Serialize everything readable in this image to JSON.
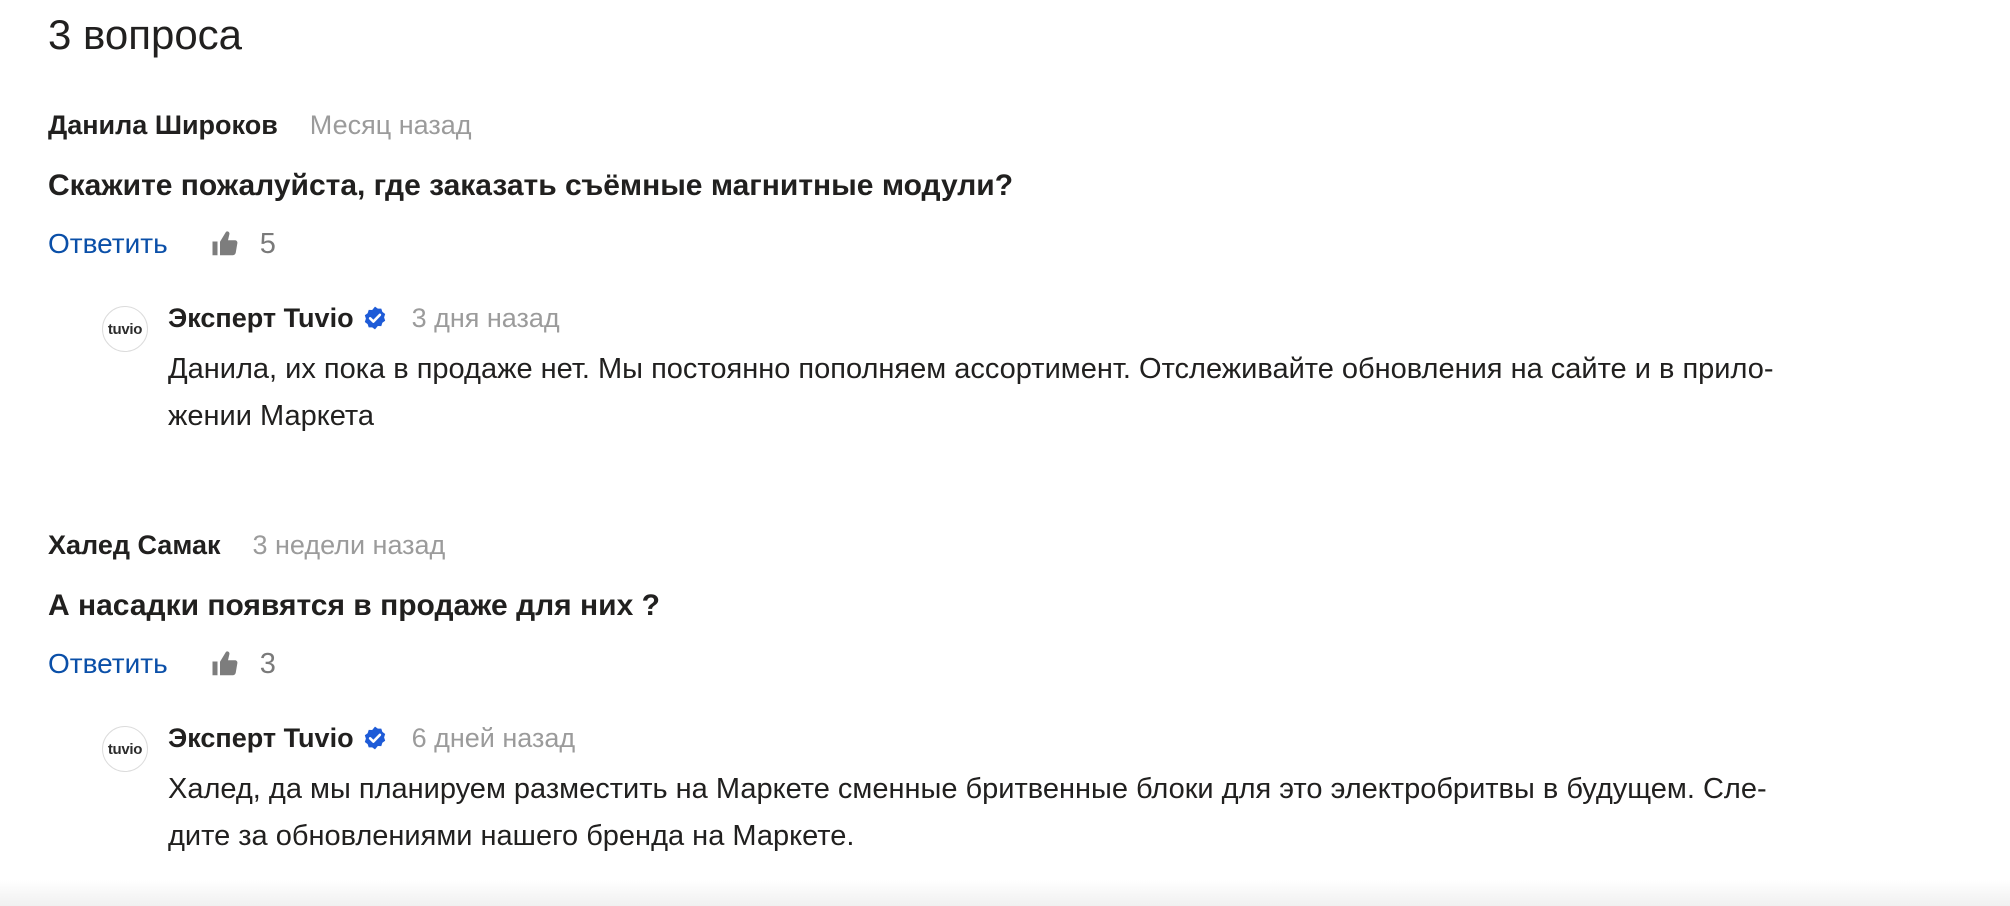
{
  "page": {
    "title": "3 вопроса"
  },
  "colors": {
    "link": "#0a4fa8",
    "muted": "#9b9b9b",
    "verified": "#1e5bd7",
    "text": "#21201f"
  },
  "questions": [
    {
      "author": "Данила Широков",
      "date": "Месяц назад",
      "text": "Скажите пожалуйста, где заказать съёмные магнитные модули?",
      "reply_label": "Ответить",
      "likes": "5",
      "like_icon": "thumbs-up-icon",
      "answer": {
        "logo_text": "tuvio",
        "author": "Эксперт Tuvio",
        "verified_icon": "verified-check-icon",
        "date": "3 дня назад",
        "line1": "Данила, их пока в продаже нет. Мы постоянно пополняем ассортимент. Отслеживайте обновления на сайте и в прило-",
        "line2": "жении Маркета"
      }
    },
    {
      "author": "Халед Самак",
      "date": "3 недели назад",
      "text": "А насадки появятся в продаже для них ?",
      "reply_label": "Ответить",
      "likes": "3",
      "like_icon": "thumbs-up-icon",
      "answer": {
        "logo_text": "tuvio",
        "author": "Эксперт Tuvio",
        "verified_icon": "verified-check-icon",
        "date": "6 дней назад",
        "line1": "Халед, да мы планируем разместить на Маркете сменные бритвенные блоки для это электробритвы в будущем. Сле-",
        "line2": "дите за обновлениями нашего бренда на Маркете."
      }
    }
  ]
}
